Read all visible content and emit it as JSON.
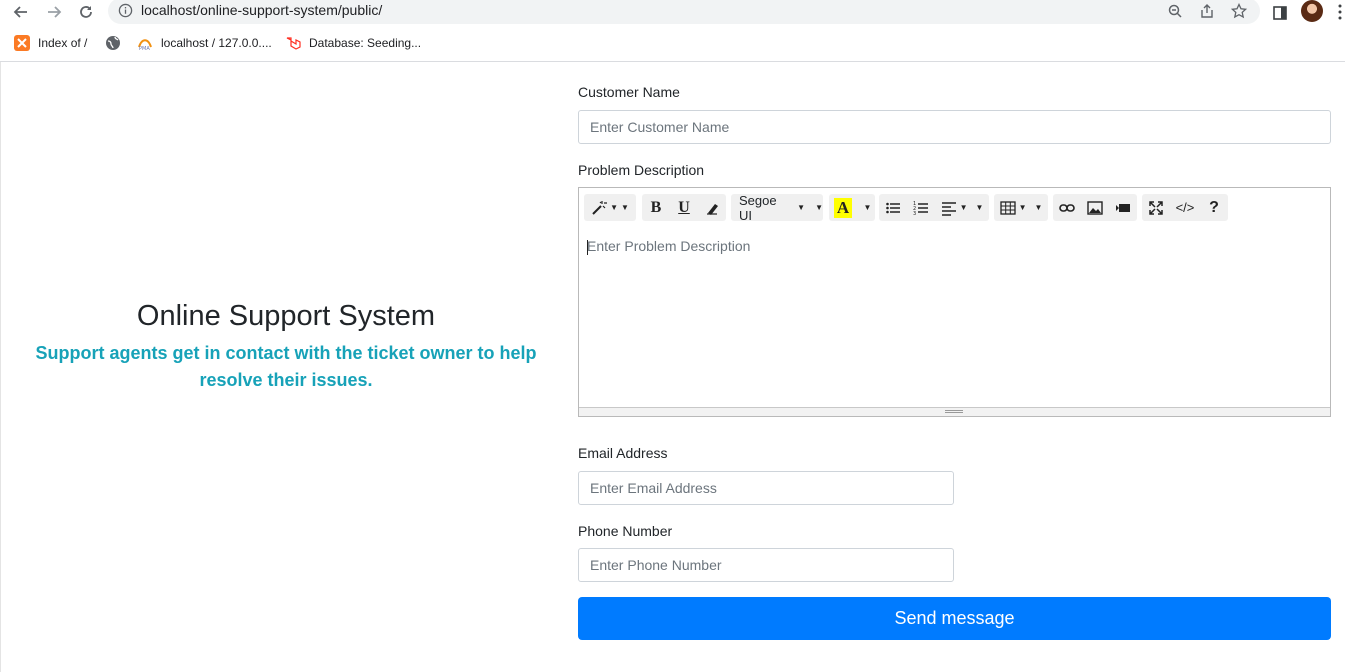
{
  "browser": {
    "url": "localhost/online-support-system/public/",
    "bookmarks": [
      {
        "label": "Index of /",
        "icon": "xampp-icon"
      },
      {
        "label": "",
        "icon": "globe-icon"
      },
      {
        "label": "localhost / 127.0.0....",
        "icon": "phpmyadmin-icon"
      },
      {
        "label": "Database: Seeding...",
        "icon": "laravel-icon"
      }
    ]
  },
  "intro": {
    "title": "Online Support System",
    "subtitle": "Support agents get in contact with the ticket owner to help resolve their issues."
  },
  "form": {
    "customer_name": {
      "label": "Customer Name",
      "placeholder": "Enter Customer Name"
    },
    "problem": {
      "label": "Problem Description",
      "placeholder": "Enter Problem Description"
    },
    "email": {
      "label": "Email Address",
      "placeholder": "Enter Email Address"
    },
    "phone": {
      "label": "Phone Number",
      "placeholder": "Enter Phone Number"
    },
    "submit_label": "Send message"
  },
  "editor_toolbar": {
    "font_name": "Segoe UI",
    "bold": "B",
    "underline": "U",
    "highlight": "A",
    "code": "</>",
    "help": "?"
  },
  "colors": {
    "accent_blue": "#007bff",
    "subtitle_teal": "#17a2b8",
    "highlight_yellow": "#ffff00"
  }
}
